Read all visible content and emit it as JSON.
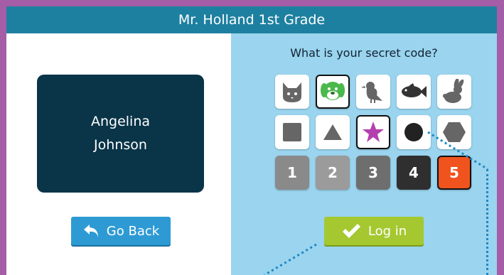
{
  "header": {
    "title": "Mr. Holland 1st Grade"
  },
  "student": {
    "first_name": "Angelina",
    "last_name": "Johnson"
  },
  "buttons": {
    "go_back_label": "Go Back",
    "login_label": "Log in"
  },
  "code_panel": {
    "prompt": "What is your secret code?",
    "animals": [
      {
        "name": "cat",
        "selected": false
      },
      {
        "name": "dog",
        "selected": true
      },
      {
        "name": "bird",
        "selected": false
      },
      {
        "name": "fish",
        "selected": false
      },
      {
        "name": "rabbit",
        "selected": false
      }
    ],
    "shapes": [
      {
        "name": "square",
        "selected": false
      },
      {
        "name": "triangle",
        "selected": false
      },
      {
        "name": "star",
        "selected": true
      },
      {
        "name": "circle",
        "selected": false
      },
      {
        "name": "hexagon",
        "selected": false
      }
    ],
    "numbers": [
      {
        "label": "1",
        "color": "#8a8a8a",
        "selected": false
      },
      {
        "label": "2",
        "color": "#9b9b9b",
        "selected": false
      },
      {
        "label": "3",
        "color": "#6e6e6e",
        "selected": false
      },
      {
        "label": "4",
        "color": "#2f2f2f",
        "selected": false
      },
      {
        "label": "5",
        "color": "#f0531e",
        "selected": true
      }
    ]
  },
  "colors": {
    "title_bar": "#1e80a0",
    "frame": "#a45da6",
    "card": "#0a3448",
    "panel": "#9ad4ee",
    "login": "#a5c830",
    "go_back": "#2e9ad4",
    "dog": "#4bb84b",
    "star": "#b43faf"
  }
}
